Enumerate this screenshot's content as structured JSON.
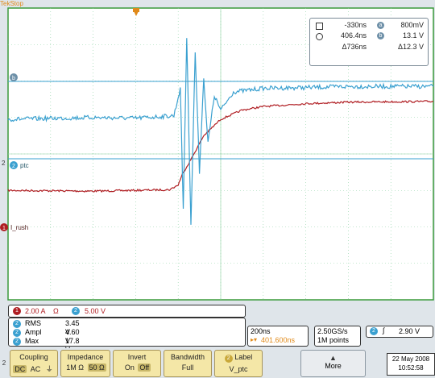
{
  "status": {
    "brand": "Tek",
    "state": "Stop"
  },
  "colors": {
    "screen_bg": "#ffffff",
    "grid": "#8ad0a0",
    "frame": "#3a9a3a",
    "ch1": "#b01e23",
    "ch2": "#3aa0d0",
    "accent": "#e08a1a"
  },
  "markers": {
    "b": "b",
    "ptc": "ptc",
    "ptc_num": "2",
    "rush": "I_rush",
    "rush_num": "1",
    "side_2": "2"
  },
  "chart_data": {
    "type": "line",
    "title": "",
    "xlabel": "",
    "ylabel": "",
    "grid": true,
    "note": "x in time divisions (0–10, 200ns/div, trigger at 4.1 div); y in screen divisions (0 top – 8 bottom)",
    "series": [
      {
        "name": "I_rush",
        "x": [
          0,
          2.0,
          3.8,
          4.0,
          4.1,
          4.3,
          4.6,
          5.0,
          5.5,
          6.0,
          7.0,
          8.0,
          10.0
        ],
        "y": [
          5.0,
          5.02,
          4.98,
          4.85,
          4.55,
          4.15,
          3.5,
          3.05,
          2.8,
          2.7,
          2.62,
          2.58,
          2.56
        ]
      },
      {
        "name": "V_ptc",
        "x": [
          0,
          2.0,
          3.0,
          3.9,
          4.05,
          4.12,
          4.2,
          4.3,
          4.4,
          4.5,
          4.6,
          4.7,
          4.85,
          5.0,
          5.3,
          6.0,
          7.0,
          8.0,
          10.0
        ],
        "y": [
          3.05,
          3.0,
          3.02,
          2.95,
          2.2,
          5.5,
          0.8,
          5.9,
          1.2,
          4.5,
          1.9,
          3.7,
          2.4,
          2.8,
          2.3,
          2.2,
          2.18,
          2.15,
          2.15
        ]
      }
    ]
  },
  "cursors": {
    "row1": {
      "label": "-330ns",
      "b_label": "a",
      "value": "800mV"
    },
    "row2": {
      "label": "406.4ns",
      "b_label": "b",
      "value": "13.1 V"
    },
    "row3": {
      "delta_t": "Δ736ns",
      "delta_v": "Δ12.3 V"
    }
  },
  "channels": {
    "ch1": {
      "num": "1",
      "scale": "2.00 A",
      "ohm": "Ω"
    },
    "ch2": {
      "num": "2",
      "scale": "5.00 V"
    }
  },
  "measurements": [
    {
      "ch": "2",
      "name": "RMS",
      "value": "3.45 V"
    },
    {
      "ch": "2",
      "name": "Ampl",
      "value": "4.60 V"
    },
    {
      "ch": "2",
      "name": "Max",
      "value": "17.8 V"
    }
  ],
  "horizontal": {
    "timebase": "200ns",
    "trigger_pos": "401.600ns",
    "sample_rate": "2.50GS/s",
    "points": "1M points"
  },
  "trigger": {
    "ch": "2",
    "level": "2.90 V"
  },
  "menu": {
    "coupling": {
      "title": "Coupling",
      "opts": [
        "DC",
        "AC",
        "⏚"
      ]
    },
    "impedance": {
      "title": "Impedance",
      "opts": [
        "1M Ω",
        "50 Ω"
      ]
    },
    "invert": {
      "title": "Invert",
      "opts": [
        "On",
        "Off"
      ]
    },
    "bandwidth": {
      "title": "Bandwidth",
      "value": "Full"
    },
    "label": {
      "ch": "2",
      "title": "Label",
      "value": "V_ptc"
    },
    "more": "More"
  },
  "datetime": {
    "date": "22 May 2008",
    "time": "10:52:58"
  }
}
